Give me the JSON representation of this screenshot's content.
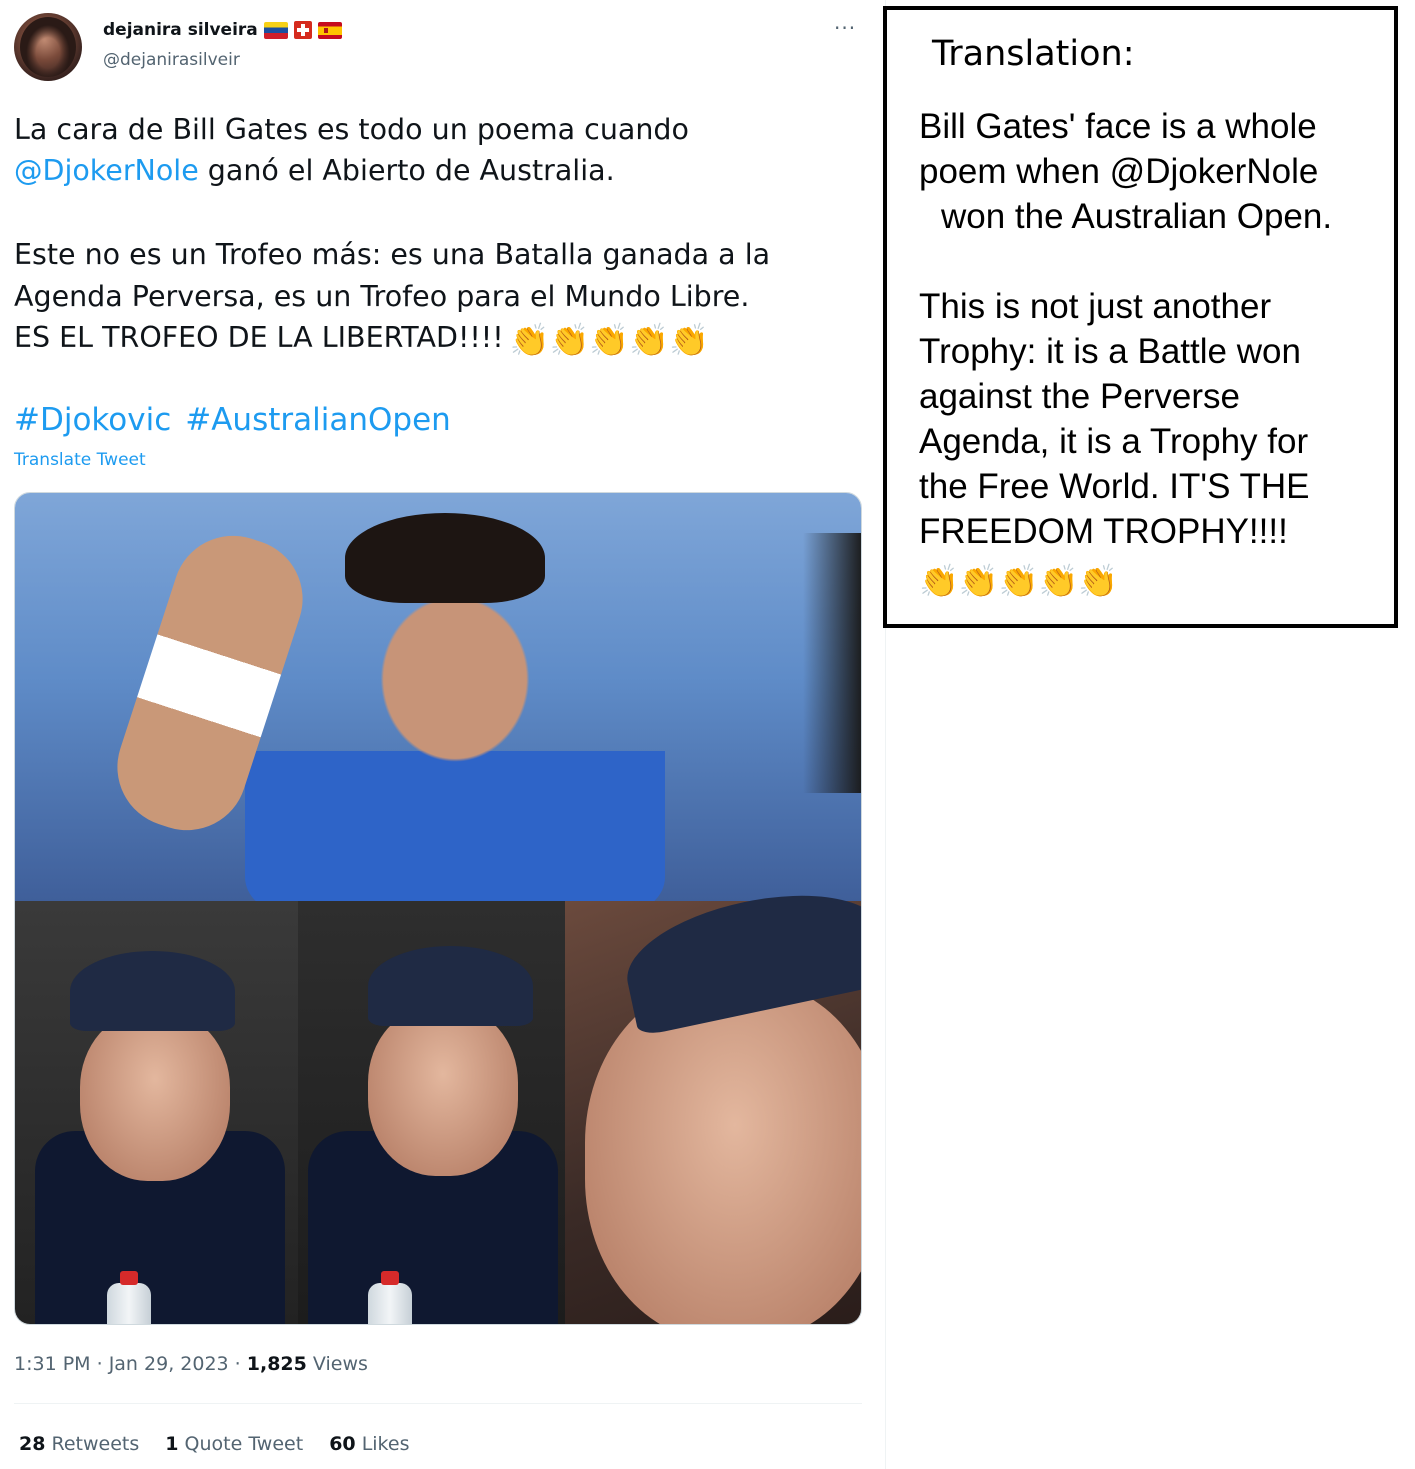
{
  "tweet": {
    "author_name": "dejanira silveira",
    "author_handle": "@dejanirasilveir",
    "more_glyph": "···",
    "line1": "La cara de Bill Gates es todo un poema cuando",
    "mention": "@DjokerNole",
    "line2_rest": " ganó el Abierto de Australia.",
    "line3": "Este no es un Trofeo más: es una Batalla ganada a la",
    "line4": "Agenda Perversa,  es un Trofeo para el Mundo Libre.",
    "line5": "ES EL TROFEO DE LA LIBERTAD!!!!",
    "clap": "👏",
    "hashtags": [
      "#Djokovic",
      "#AustralianOpen"
    ],
    "translate_label": "Translate Tweet",
    "time": "1:31 PM",
    "date": "Jan 29, 2023",
    "views_count": "1,825",
    "views_label": "Views",
    "retweets_count": "28",
    "retweets_label": "Retweets",
    "quotes_count": "1",
    "quotes_label": "Quote Tweet",
    "likes_count": "60",
    "likes_label": "Likes",
    "link_color": "#1d9bf0"
  },
  "translation": {
    "heading": "Translation:",
    "lines_a": [
      "Bill Gates' face is a whole",
      "poem when @DjokerNole",
      "won the Australian Open."
    ],
    "lines_b": [
      "This is not just another",
      "Trophy: it is a Battle won",
      "against the Perverse",
      "Agenda, it is a Trophy for",
      "the Free World. IT'S THE",
      "FREEDOM TROPHY!!!!"
    ]
  }
}
